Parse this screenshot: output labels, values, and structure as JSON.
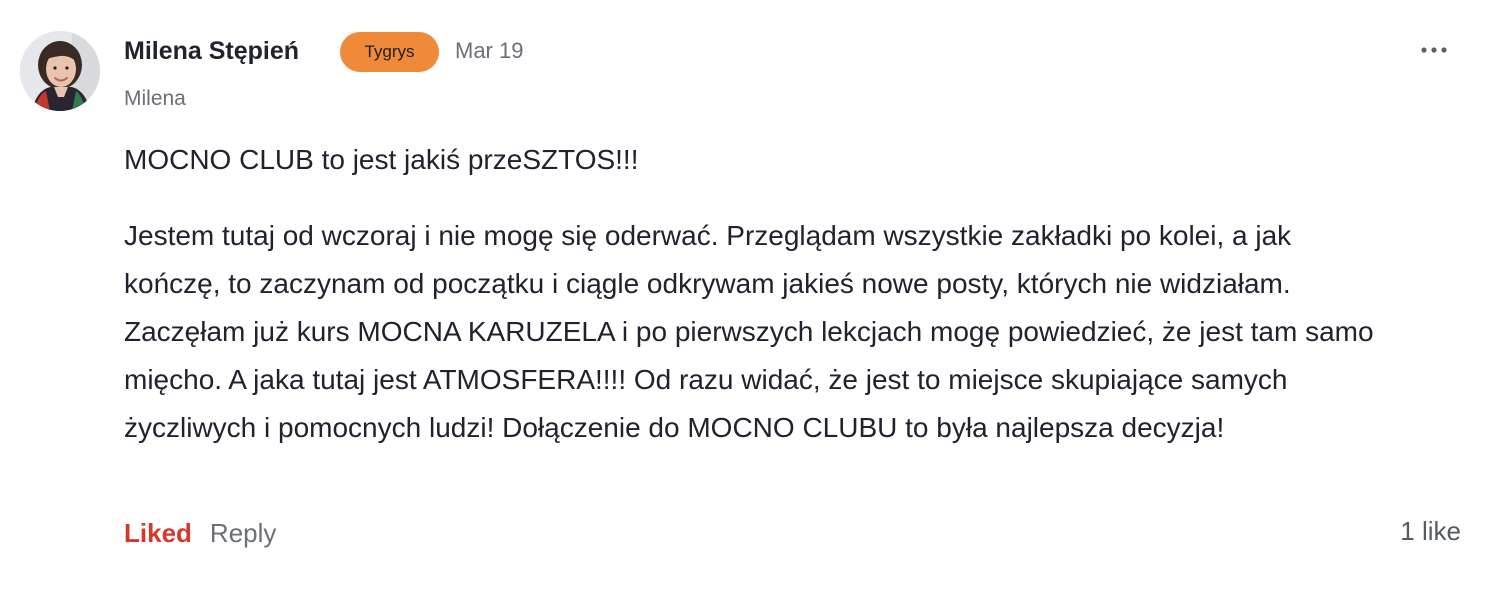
{
  "comment": {
    "author": {
      "name": "Milena Stępień",
      "badge": "Tygrys",
      "username": "Milena"
    },
    "date": "Mar 19",
    "paragraphs": [
      "MOCNO CLUB to jest jakiś przeSZTOS!!!",
      "Jestem tutaj od wczoraj i nie mogę się oderwać. Przeglądam wszystkie zakładki po kolei, a jak kończę, to zaczynam od początku i ciągle odkrywam jakieś nowe posty, których nie widziałam. Zaczęłam już kurs MOCNA KARUZELA i po pierwszych lekcjach mogę powiedzieć, że jest tam samo mięcho. A jaka tutaj jest ATMOSFERA!!!! Od razu widać, że jest to miejsce skupiające samych życzliwych i pomocnych ludzi! Dołączenie do MOCNO CLUBU to była najlepsza decyzja!"
    ],
    "actions": {
      "liked_label": "Liked",
      "reply_label": "Reply"
    },
    "like_count": "1 like"
  },
  "icons": {
    "more": "more-horizontal-icon"
  },
  "colors": {
    "badge_bg": "#f08a3b",
    "liked": "#d9362b",
    "muted": "#6b6f78",
    "text": "#20232d"
  }
}
